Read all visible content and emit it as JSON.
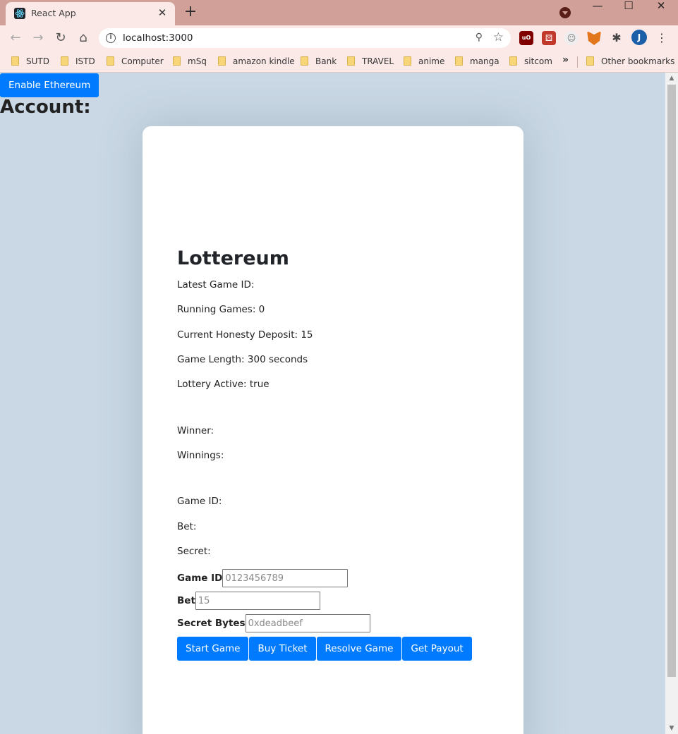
{
  "browser": {
    "tab_title": "React App",
    "tab_close": "✕",
    "new_tab": "+",
    "url": "localhost:3000",
    "avatar_initial": "J",
    "bookmarks": [
      "SUTD",
      "ISTD",
      "Computer",
      "mSq",
      "amazon kindle",
      "Bank",
      "TRAVEL",
      "anime",
      "manga",
      "sitcom"
    ],
    "bookmarks_more": "»",
    "other_bookmarks": "Other bookmarks"
  },
  "page": {
    "enable_button": "Enable Ethereum",
    "account_heading": "Account:"
  },
  "card": {
    "title": "Lottereum",
    "info": [
      "Latest Game ID:",
      "Running Games: 0",
      "Current Honesty Deposit: 15",
      "Game Length: 300 seconds",
      "Lottery Active: true"
    ],
    "result": [
      "Winner:",
      "Winnings:"
    ],
    "ticket": [
      "Game ID:",
      "Bet:",
      "Secret:"
    ],
    "form": {
      "game_id_label": "Game ID",
      "game_id_placeholder": "0123456789",
      "bet_label": "Bet",
      "bet_placeholder": "15",
      "secret_label": "Secret Bytes",
      "secret_placeholder": "0xdeadbeef"
    },
    "buttons": [
      "Start Game",
      "Buy Ticket",
      "Resolve Game",
      "Get Payout"
    ]
  },
  "colors": {
    "primary": "#007bff",
    "page_background": "#c9d8e4",
    "browser_frame": "#d1a199"
  }
}
